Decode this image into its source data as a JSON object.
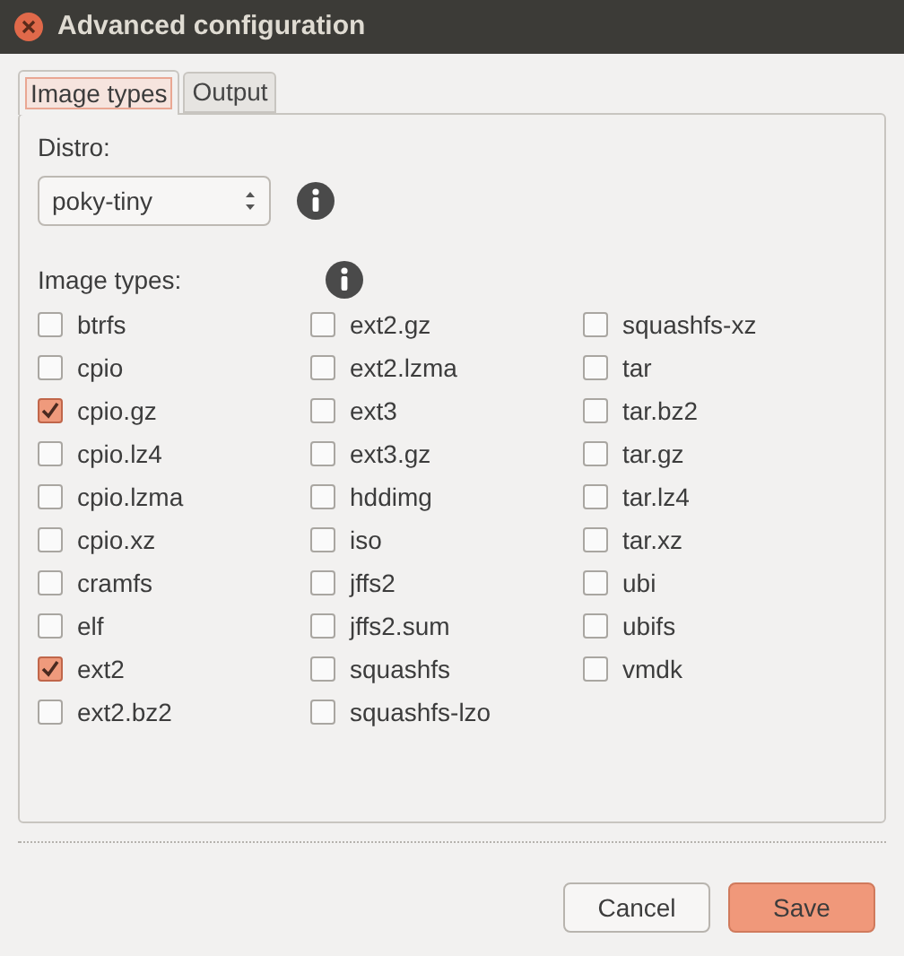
{
  "window": {
    "title": "Advanced configuration"
  },
  "tabs": [
    {
      "label": "Image types",
      "selected": true
    },
    {
      "label": "Output",
      "selected": false
    }
  ],
  "distro": {
    "label": "Distro:",
    "value": "poky-tiny"
  },
  "image_types": {
    "label": "Image types:",
    "items": [
      {
        "label": "btrfs",
        "checked": false
      },
      {
        "label": "cpio",
        "checked": false
      },
      {
        "label": "cpio.gz",
        "checked": true
      },
      {
        "label": "cpio.lz4",
        "checked": false
      },
      {
        "label": "cpio.lzma",
        "checked": false
      },
      {
        "label": "cpio.xz",
        "checked": false
      },
      {
        "label": "cramfs",
        "checked": false
      },
      {
        "label": "elf",
        "checked": false
      },
      {
        "label": "ext2",
        "checked": true
      },
      {
        "label": "ext2.bz2",
        "checked": false
      },
      {
        "label": "ext2.gz",
        "checked": false
      },
      {
        "label": "ext2.lzma",
        "checked": false
      },
      {
        "label": "ext3",
        "checked": false
      },
      {
        "label": "ext3.gz",
        "checked": false
      },
      {
        "label": "hddimg",
        "checked": false
      },
      {
        "label": "iso",
        "checked": false
      },
      {
        "label": "jffs2",
        "checked": false
      },
      {
        "label": "jffs2.sum",
        "checked": false
      },
      {
        "label": "squashfs",
        "checked": false
      },
      {
        "label": "squashfs-lzo",
        "checked": false
      },
      {
        "label": "squashfs-xz",
        "checked": false
      },
      {
        "label": "tar",
        "checked": false
      },
      {
        "label": "tar.bz2",
        "checked": false
      },
      {
        "label": "tar.gz",
        "checked": false
      },
      {
        "label": "tar.lz4",
        "checked": false
      },
      {
        "label": "tar.xz",
        "checked": false
      },
      {
        "label": "ubi",
        "checked": false
      },
      {
        "label": "ubifs",
        "checked": false
      },
      {
        "label": "vmdk",
        "checked": false
      }
    ]
  },
  "buttons": [
    {
      "label": "Cancel",
      "kind": "secondary"
    },
    {
      "label": "Save",
      "kind": "primary"
    }
  ]
}
